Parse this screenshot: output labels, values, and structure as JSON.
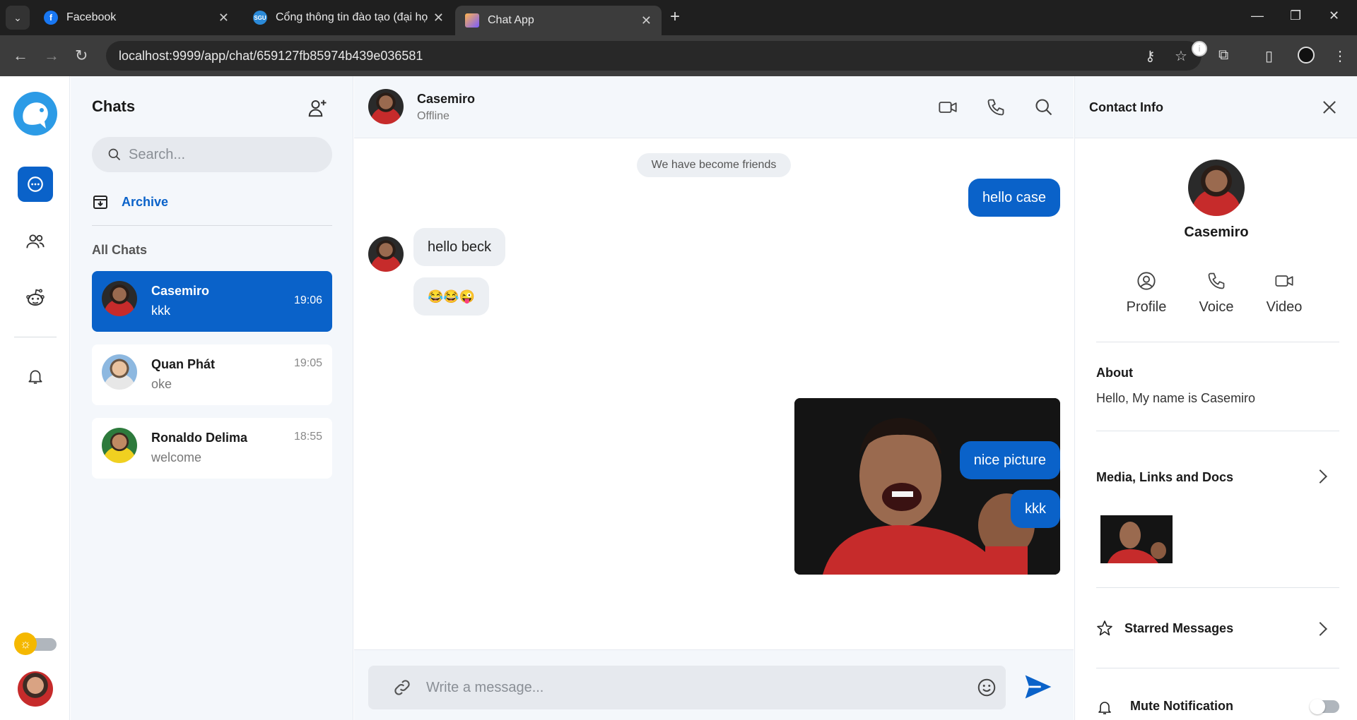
{
  "browser": {
    "tabs": [
      {
        "title": "Facebook",
        "favicon": "facebook-icon",
        "color": "#1877f2"
      },
      {
        "title": "Cổng thông tin đào tạo (đại họ",
        "favicon": "sgu-icon",
        "color": "#2b8ad8"
      },
      {
        "title": "Chat App",
        "favicon": "chat-app-icon",
        "color": "#7a5cff"
      }
    ],
    "url": "localhost:9999/app/chat/659127fb85974b439e036581"
  },
  "sidebar": {
    "accent": "#0a62c9"
  },
  "chat_list": {
    "title": "Chats",
    "search_placeholder": "Search...",
    "archive_label": "Archive",
    "section_label": "All Chats",
    "items": [
      {
        "name": "Casemiro",
        "last_message": "kkk",
        "time": "19:06",
        "active": true
      },
      {
        "name": "Quan Phát",
        "last_message": "oke",
        "time": "19:05",
        "active": false
      },
      {
        "name": "Ronaldo Delima",
        "last_message": "welcome",
        "time": "18:55",
        "active": false
      }
    ]
  },
  "conversation": {
    "contact_name": "Casemiro",
    "status": "Offline",
    "system_note": "We have become friends",
    "messages": [
      {
        "dir": "out",
        "text": "hello case"
      },
      {
        "dir": "in",
        "text": "hello beck"
      },
      {
        "dir": "in",
        "text": "😂😂😜"
      },
      {
        "dir": "out",
        "type": "image"
      },
      {
        "dir": "out",
        "text": "nice picture"
      },
      {
        "dir": "out",
        "text": "kkk"
      }
    ],
    "composer_placeholder": "Write a message..."
  },
  "contact_info": {
    "title": "Contact Info",
    "name": "Casemiro",
    "actions": [
      {
        "label": "Profile",
        "icon": "user-circle-icon"
      },
      {
        "label": "Voice",
        "icon": "phone-icon"
      },
      {
        "label": "Video",
        "icon": "video-icon"
      }
    ],
    "about_title": "About",
    "about_text": "Hello, My name is Casemiro",
    "media_title": "Media, Links and Docs",
    "starred_title": "Starred Messages",
    "mute_title": "Mute Notification"
  }
}
